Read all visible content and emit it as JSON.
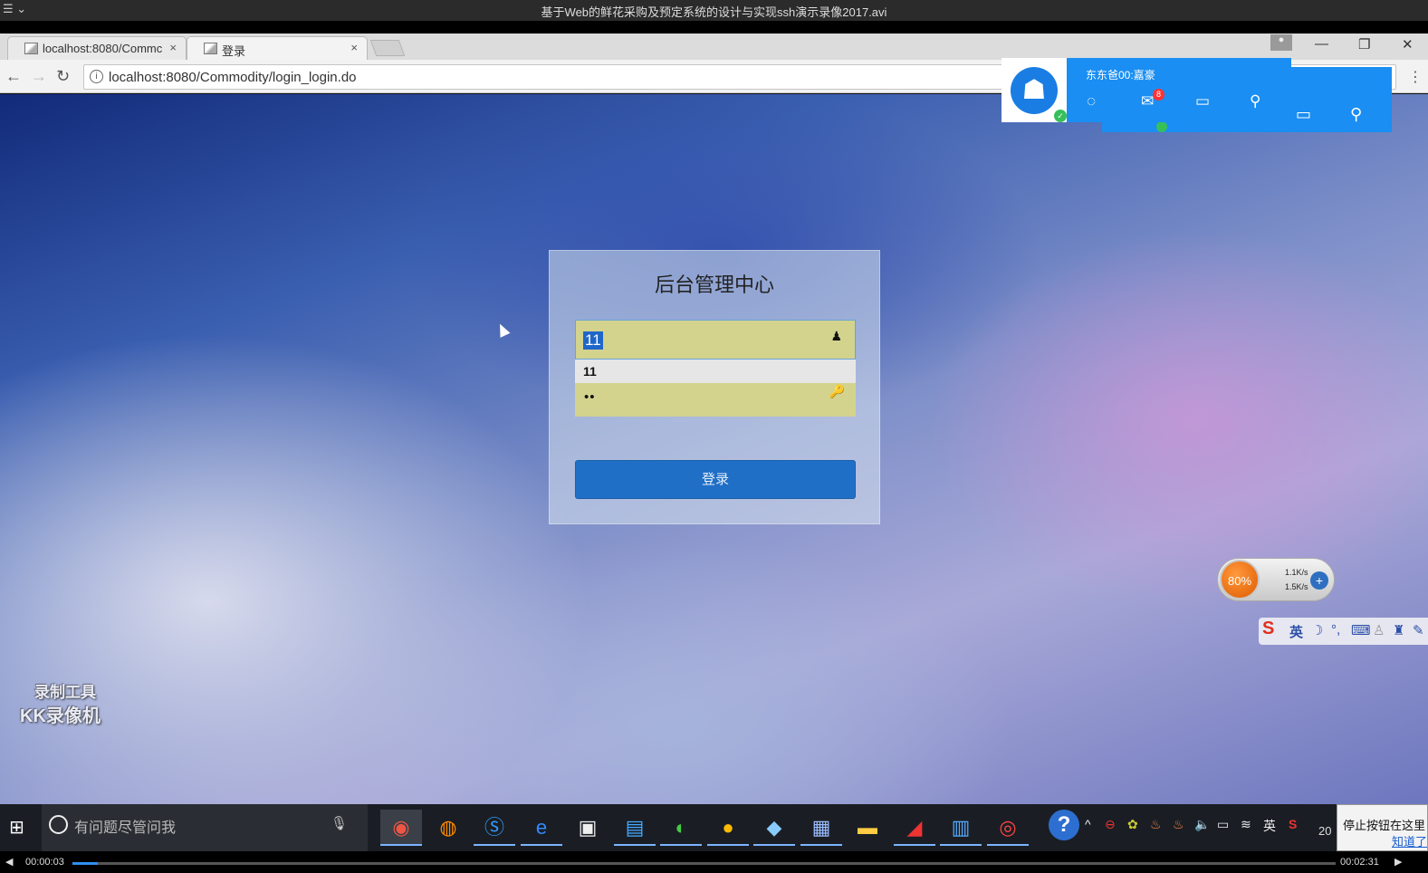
{
  "player": {
    "title": "基于Web的鲜花采购及预定系统的设计与实现ssh演示录像2017.avi",
    "elapsed": "00:00:03",
    "total": "00:02:31",
    "progress": 0.02
  },
  "browser": {
    "tabs": [
      {
        "label": "localhost:8080/Commc"
      },
      {
        "label": "登录"
      }
    ],
    "url": "localhost:8080/Commodity/login_login.do"
  },
  "login": {
    "title": "后台管理中心",
    "username_value": "11",
    "autocomplete_suggestion": "11",
    "password_value": "••",
    "submit_label": "登录"
  },
  "qq_panel": {
    "name": "东东爸00:嘉豪",
    "mail_badge": "8"
  },
  "net_speed": {
    "percent": "80%",
    "upload": "1.1K/s",
    "download": "1.5K/s"
  },
  "ime": {
    "mode": "英"
  },
  "watermark": {
    "line1": "录制工具",
    "line2": "KK录像机"
  },
  "taskbar": {
    "search_placeholder": "有问题尽管问我",
    "ime_indicator": "英",
    "clock_partial": "20",
    "notification": "停止按钮在这里",
    "notification_link": "知道了"
  },
  "colors": {
    "login_button": "#1f6fc7",
    "autofill": "#d3d38e",
    "qq_blue": "#1a8ef2",
    "taskbar": "#1a1e24"
  }
}
